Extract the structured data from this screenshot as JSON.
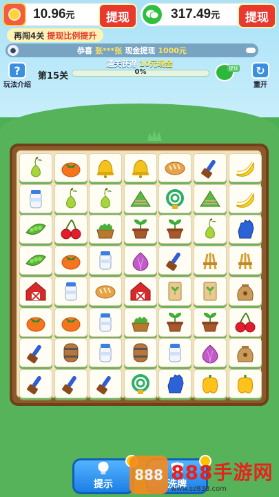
{
  "wallet": {
    "coins_amount": "10.96",
    "coins_unit": "元",
    "coins_withdraw": "提现",
    "wechat_amount": "317.49",
    "wechat_unit": "元",
    "wechat_withdraw": "提现"
  },
  "promo": {
    "prefix": "再闯4关",
    "highlight": "提现比例提升"
  },
  "ticker": {
    "congrats": "恭喜",
    "user": "张***张",
    "action": "现金提现",
    "amount": "1000元"
  },
  "reward": {
    "prefix": "通关获得",
    "amount": "10元现金"
  },
  "help": {
    "label": "玩法介绍",
    "glyph": "?"
  },
  "reset": {
    "label": "重开",
    "glyph": "↻"
  },
  "level": {
    "label": "第15关",
    "progress_text": "0%",
    "progress_fraction": 0
  },
  "gift_tag": "提现",
  "grid": [
    [
      "pear",
      "persimmon",
      "bell",
      "bell",
      "bread",
      "brush",
      "banana"
    ],
    [
      "milk",
      "pear",
      "pear",
      "rice-dumpling",
      "hose",
      "rice-dumpling",
      "banana"
    ],
    [
      "peapod",
      "cherry",
      "basket",
      "sprout-pot",
      "sprout-pot",
      "pear",
      "glove"
    ],
    [
      "peapod",
      "persimmon",
      "milk",
      "onion",
      "brush",
      "wheat",
      "wheat"
    ],
    [
      "barn",
      "milk",
      "bread",
      "barn",
      "seed-packet",
      "seed-packet",
      "sack"
    ],
    [
      "persimmon",
      "persimmon",
      "milk",
      "basket",
      "sprout-pot",
      "sprout-pot",
      "cherry"
    ],
    [
      "brush",
      "barrel",
      "milk",
      "barrel",
      "milk",
      "onion",
      "sack"
    ],
    [
      "brush",
      "brush",
      "brush",
      "hose",
      "glove",
      "bell-pepper",
      "bell-pepper"
    ]
  ],
  "buttons": {
    "hint": "提示",
    "shuffle": "洗牌"
  },
  "watermark": {
    "logo": "888",
    "title": "888手游网",
    "url": "www.sz838.com"
  },
  "colors": {
    "sky": "#a8e2f7",
    "grass": "#56b35a",
    "frame": "#8c5a2a",
    "board": "#f3e2b7",
    "accent_red": "#e8392f",
    "button_blue": "#1b7ee6"
  }
}
